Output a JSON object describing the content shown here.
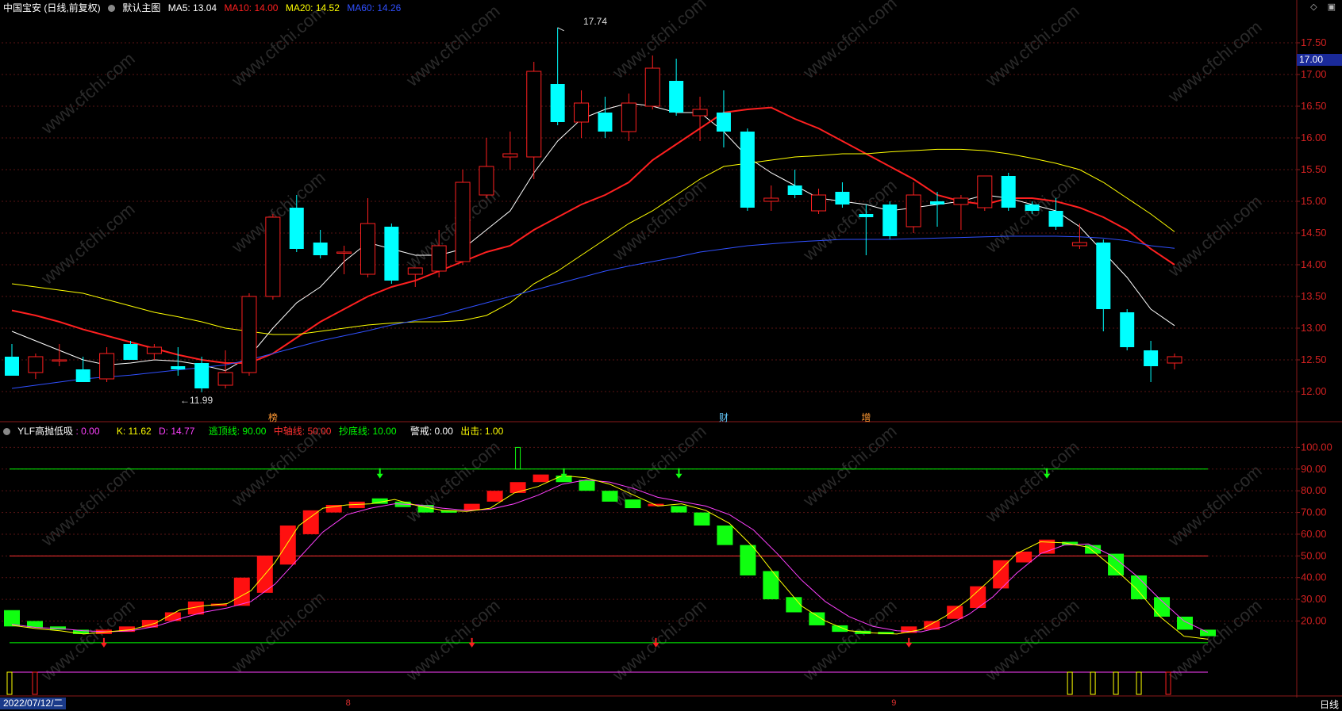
{
  "header_main": {
    "title": "中国宝安 (日线,前复权)",
    "template": "默认主图",
    "ma": [
      {
        "label": "MA5: 13.04",
        "color": "#ffffff"
      },
      {
        "label": "MA10: 14.00",
        "color": "#ff2020"
      },
      {
        "label": "MA20: 14.52",
        "color": "#ffff00"
      },
      {
        "label": "MA60: 14.26",
        "color": "#3050ff"
      }
    ]
  },
  "header_sub": {
    "title": "YLF高抛低吸",
    "items": [
      {
        "label": ": 0.00",
        "color": "#ff40ff"
      },
      {
        "label": "K: 11.62",
        "color": "#ffff00"
      },
      {
        "label": "D: 14.77",
        "color": "#ff40ff"
      },
      {
        "label": "逃顶线: 90.00",
        "color": "#00ff00"
      },
      {
        "label": "中轴线: 50.00",
        "color": "#ff3030"
      },
      {
        "label": "抄底线: 10.00",
        "color": "#00ff00"
      },
      {
        "label": "警戒: 0.00",
        "color": "#ffffff"
      },
      {
        "label": "出击: 1.00",
        "color": "#ffff00"
      }
    ]
  },
  "watermark": "www.cfchi.com",
  "current_price": "17.00",
  "annotations": {
    "high_label": "17.74",
    "low_label": "←11.99",
    "event_markers": [
      {
        "text": "榜",
        "index": 11,
        "color": "#ff9933"
      },
      {
        "text": "财",
        "index": 30,
        "color": "#66ccff"
      },
      {
        "text": "增",
        "index": 36,
        "color": "#ff9933"
      }
    ]
  },
  "bottom": {
    "date": "2022/07/12/二",
    "month_marks": [
      {
        "text": "8",
        "index": 14
      },
      {
        "text": "9",
        "index": 37
      }
    ],
    "period": "日线"
  },
  "chart_data": [
    {
      "type": "candlestick",
      "y_ticks": [
        "12.00",
        "12.50",
        "13.00",
        "13.50",
        "14.00",
        "14.50",
        "15.00",
        "15.50",
        "16.00",
        "16.50",
        "17.00",
        "17.50"
      ],
      "ylim": [
        11.7,
        17.95
      ],
      "bull_color": "#ff2020",
      "bear_color": "#00ffff",
      "ohlc": [
        [
          12.55,
          12.75,
          12.25,
          12.25
        ],
        [
          12.3,
          12.6,
          12.2,
          12.55
        ],
        [
          12.5,
          12.75,
          12.4,
          12.5
        ],
        [
          12.35,
          12.55,
          12.15,
          12.15
        ],
        [
          12.2,
          12.7,
          12.15,
          12.6
        ],
        [
          12.75,
          12.8,
          12.5,
          12.5
        ],
        [
          12.6,
          12.75,
          12.5,
          12.7
        ],
        [
          12.4,
          12.7,
          12.25,
          12.35
        ],
        [
          12.45,
          12.55,
          11.99,
          12.05
        ],
        [
          12.1,
          12.65,
          12.05,
          12.3
        ],
        [
          12.3,
          13.55,
          12.25,
          13.5
        ],
        [
          13.5,
          14.8,
          13.45,
          14.75
        ],
        [
          14.9,
          15.1,
          14.2,
          14.25
        ],
        [
          14.35,
          14.55,
          14.1,
          14.15
        ],
        [
          14.2,
          14.3,
          13.85,
          14.2
        ],
        [
          13.85,
          15.05,
          13.8,
          14.65
        ],
        [
          14.6,
          14.65,
          13.7,
          13.75
        ],
        [
          13.85,
          13.95,
          13.65,
          13.95
        ],
        [
          13.9,
          14.55,
          13.8,
          14.3
        ],
        [
          14.05,
          15.5,
          14.0,
          15.3
        ],
        [
          15.1,
          16.0,
          15.05,
          15.55
        ],
        [
          15.7,
          16.1,
          15.5,
          15.75
        ],
        [
          15.7,
          17.2,
          15.35,
          17.05
        ],
        [
          16.85,
          17.74,
          16.2,
          16.25
        ],
        [
          16.25,
          16.75,
          16.0,
          16.55
        ],
        [
          16.4,
          16.65,
          16.0,
          16.1
        ],
        [
          16.1,
          16.7,
          15.95,
          16.55
        ],
        [
          16.5,
          17.3,
          16.45,
          17.1
        ],
        [
          16.9,
          17.25,
          16.35,
          16.4
        ],
        [
          16.35,
          16.65,
          15.95,
          16.45
        ],
        [
          16.4,
          16.75,
          15.85,
          16.1
        ],
        [
          16.1,
          16.15,
          14.85,
          14.9
        ],
        [
          15.0,
          15.25,
          14.85,
          15.05
        ],
        [
          15.25,
          15.5,
          15.05,
          15.1
        ],
        [
          14.85,
          15.2,
          14.8,
          15.1
        ],
        [
          15.15,
          15.3,
          14.9,
          14.95
        ],
        [
          14.8,
          14.95,
          14.15,
          14.75
        ],
        [
          14.95,
          15.0,
          14.4,
          14.45
        ],
        [
          14.6,
          15.3,
          14.5,
          15.1
        ],
        [
          15.0,
          15.15,
          14.6,
          14.95
        ],
        [
          14.95,
          15.1,
          14.55,
          15.05
        ],
        [
          14.9,
          15.4,
          14.85,
          15.4
        ],
        [
          15.4,
          15.45,
          14.85,
          14.9
        ],
        [
          14.95,
          15.0,
          14.8,
          14.85
        ],
        [
          14.85,
          15.05,
          14.55,
          14.6
        ],
        [
          14.3,
          14.65,
          14.25,
          14.35
        ],
        [
          14.35,
          14.4,
          12.95,
          13.3
        ],
        [
          13.25,
          13.3,
          12.65,
          12.7
        ],
        [
          12.65,
          12.8,
          12.15,
          12.4
        ],
        [
          12.45,
          12.6,
          12.35,
          12.55
        ]
      ],
      "ma_series": [
        {
          "name": "MA5",
          "color": "#ffffff",
          "width": 1,
          "values": [
            12.95,
            12.8,
            12.65,
            12.5,
            12.42,
            12.45,
            12.5,
            12.48,
            12.42,
            12.33,
            12.55,
            13.0,
            13.4,
            13.65,
            14.05,
            14.35,
            14.25,
            14.15,
            14.15,
            14.25,
            14.55,
            14.85,
            15.45,
            15.95,
            16.3,
            16.45,
            16.55,
            16.5,
            16.4,
            16.4,
            16.1,
            15.7,
            15.45,
            15.25,
            15.05,
            15.0,
            14.95,
            14.85,
            14.9,
            14.95,
            15.0,
            15.1,
            15.05,
            14.95,
            14.85,
            14.6,
            14.2,
            13.8,
            13.3,
            13.04
          ]
        },
        {
          "name": "MA10",
          "color": "#ff2020",
          "width": 2,
          "values": [
            13.28,
            13.2,
            13.1,
            12.98,
            12.88,
            12.78,
            12.68,
            12.58,
            12.5,
            12.45,
            12.45,
            12.6,
            12.85,
            13.1,
            13.3,
            13.5,
            13.65,
            13.75,
            13.9,
            14.05,
            14.2,
            14.3,
            14.55,
            14.75,
            14.95,
            15.1,
            15.3,
            15.65,
            15.9,
            16.15,
            16.4,
            16.45,
            16.48,
            16.3,
            16.15,
            15.95,
            15.75,
            15.55,
            15.35,
            15.1,
            15.0,
            14.95,
            15.05,
            15.05,
            15.0,
            14.9,
            14.75,
            14.55,
            14.25,
            14.0
          ]
        },
        {
          "name": "MA20",
          "color": "#ffff00",
          "width": 1,
          "values": [
            13.7,
            13.65,
            13.6,
            13.55,
            13.45,
            13.35,
            13.25,
            13.18,
            13.1,
            13.0,
            12.95,
            12.9,
            12.9,
            12.95,
            13.0,
            13.05,
            13.08,
            13.1,
            13.1,
            13.12,
            13.2,
            13.4,
            13.7,
            13.9,
            14.15,
            14.4,
            14.65,
            14.85,
            15.1,
            15.35,
            15.55,
            15.6,
            15.65,
            15.7,
            15.72,
            15.75,
            15.75,
            15.78,
            15.8,
            15.82,
            15.82,
            15.8,
            15.75,
            15.68,
            15.6,
            15.5,
            15.3,
            15.05,
            14.8,
            14.52
          ]
        },
        {
          "name": "MA60",
          "color": "#3050ff",
          "width": 1,
          "values": [
            12.05,
            12.1,
            12.15,
            12.2,
            12.23,
            12.26,
            12.3,
            12.34,
            12.38,
            12.42,
            12.5,
            12.6,
            12.7,
            12.8,
            12.88,
            12.96,
            13.05,
            13.12,
            13.2,
            13.3,
            13.4,
            13.5,
            13.6,
            13.7,
            13.8,
            13.9,
            13.98,
            14.05,
            14.12,
            14.2,
            14.25,
            14.3,
            14.33,
            14.36,
            14.38,
            14.4,
            14.4,
            14.4,
            14.41,
            14.42,
            14.43,
            14.44,
            14.45,
            14.45,
            14.45,
            14.44,
            14.42,
            14.38,
            14.3,
            14.26
          ]
        }
      ]
    },
    {
      "type": "bar",
      "name": "YLF高抛低吸",
      "y_ticks": [
        "20.00",
        "30.00",
        "40.00",
        "50.00",
        "60.00",
        "70.00",
        "80.00",
        "90.00",
        "100.00"
      ],
      "ylim": [
        3,
        106
      ],
      "levels": [
        {
          "value": 90,
          "color": "#00ff00"
        },
        {
          "value": 50,
          "color": "#ff3030"
        },
        {
          "value": 10,
          "color": "#00ff00"
        }
      ],
      "k": [
        18.0,
        16.5,
        15.5,
        14.0,
        15.0,
        16.0,
        19.0,
        25.0,
        27.0,
        28.0,
        34.0,
        47.0,
        64.0,
        72.0,
        73.5,
        74.0,
        76.0,
        73.0,
        71.0,
        70.5,
        72.0,
        79.0,
        82.0,
        87.0,
        86.0,
        83.0,
        78.0,
        73.0,
        74.0,
        71.0,
        65.0,
        54.0,
        40.0,
        27.0,
        20.0,
        15.5,
        14.5,
        14.0,
        16.0,
        22.0,
        30.0,
        40.0,
        51.0,
        56.5,
        56.0,
        54.0,
        45.0,
        35.0,
        22.0,
        13.0,
        11.62
      ],
      "d": [
        18.5,
        17.0,
        16.5,
        15.5,
        15.0,
        15.5,
        17.5,
        21.0,
        24.0,
        26.0,
        29.0,
        37.0,
        49.0,
        61.0,
        69.0,
        72.0,
        74.0,
        73.5,
        72.0,
        71.0,
        71.5,
        74.0,
        78.0,
        83.0,
        85.0,
        84.0,
        81.0,
        77.0,
        75.0,
        73.0,
        69.0,
        62.0,
        51.0,
        39.0,
        29.0,
        22.0,
        17.5,
        15.5,
        15.0,
        17.5,
        23.0,
        31.0,
        42.0,
        51.0,
        55.0,
        55.5,
        50.0,
        41.0,
        30.0,
        20.0,
        14.77
      ],
      "bars": [
        [
          25,
          17.5
        ],
        [
          20,
          17
        ],
        [
          17.5,
          16
        ],
        [
          16,
          14
        ],
        [
          14,
          16
        ],
        [
          15,
          17.5
        ],
        [
          17,
          20.5
        ],
        [
          20,
          24
        ],
        [
          23,
          29
        ],
        [
          27.5,
          28
        ],
        [
          27,
          40
        ],
        [
          33,
          50
        ],
        [
          46,
          64
        ],
        [
          60,
          71
        ],
        [
          70,
          73.5
        ],
        [
          72,
          75
        ],
        [
          76.5,
          74
        ],
        [
          75,
          72.5
        ],
        [
          73.5,
          70
        ],
        [
          70,
          71
        ],
        [
          71,
          74
        ],
        [
          75,
          80
        ],
        [
          79,
          84
        ],
        [
          84,
          87.5
        ],
        [
          87,
          84
        ],
        [
          85,
          80
        ],
        [
          80,
          75
        ],
        [
          76,
          72
        ],
        [
          73.5,
          74
        ],
        [
          73,
          70
        ],
        [
          70,
          64
        ],
        [
          64,
          55
        ],
        [
          55,
          41
        ],
        [
          43,
          30
        ],
        [
          31,
          24
        ],
        [
          24,
          18
        ],
        [
          18,
          15
        ],
        [
          15.5,
          14
        ],
        [
          15,
          14.5
        ],
        [
          14.5,
          17.5
        ],
        [
          16,
          20
        ],
        [
          21,
          27
        ],
        [
          26,
          36
        ],
        [
          35,
          48
        ],
        [
          47,
          52
        ],
        [
          51,
          57.5
        ],
        [
          56.5,
          55
        ],
        [
          55,
          51
        ],
        [
          51,
          41
        ],
        [
          41,
          30
        ],
        [
          31,
          22
        ],
        [
          22,
          16
        ],
        [
          16,
          13
        ]
      ],
      "bars_dir": [
        0,
        0,
        0,
        0,
        1,
        1,
        1,
        1,
        1,
        1,
        1,
        1,
        1,
        1,
        1,
        1,
        0,
        0,
        0,
        0,
        1,
        1,
        1,
        1,
        0,
        0,
        0,
        0,
        1,
        0,
        0,
        0,
        0,
        0,
        0,
        0,
        0,
        0,
        0,
        1,
        1,
        1,
        1,
        1,
        1,
        1,
        0,
        0,
        0,
        0,
        0,
        0,
        0
      ],
      "up_arrows": [
        4,
        20,
        28,
        39
      ],
      "down_arrows": [
        16,
        24,
        29,
        45
      ],
      "spike_index": 22,
      "spike_value": 100,
      "flag_ticks_yellow": [
        0,
        45,
        46,
        47,
        48
      ],
      "flag_ticks_red": [
        1,
        49
      ]
    }
  ]
}
